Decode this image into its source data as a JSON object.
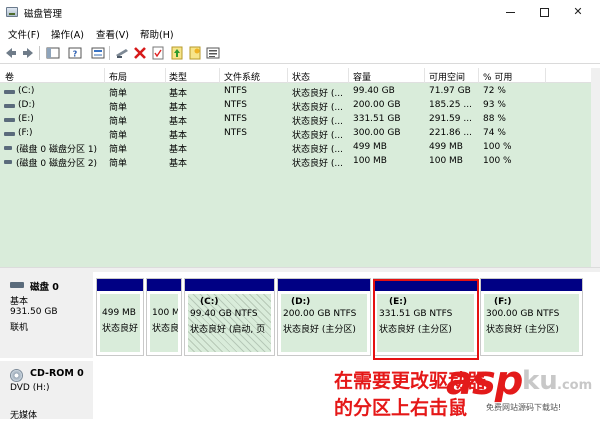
{
  "window": {
    "title": "磁盘管理",
    "min_label": "",
    "max_label": "",
    "close_label": "✕"
  },
  "menu": [
    "文件(F)",
    "操作(A)",
    "查看(V)",
    "帮助(H)"
  ],
  "toolbar_icons": [
    "back-arrow-icon",
    "forward-arrow-icon",
    "console-tree-icon",
    "help-icon",
    "properties-icon",
    "connect-drive-icon",
    "delete-icon",
    "check-icon",
    "up-folder-icon",
    "new-folder-icon",
    "list-view-icon"
  ],
  "columns": [
    "卷",
    "布局",
    "类型",
    "文件系统",
    "状态",
    "容量",
    "可用空间",
    "% 可用"
  ],
  "volumes": [
    {
      "vol": "(C:)",
      "layout": "简单",
      "type": "基本",
      "fs": "NTFS",
      "status": "状态良好 (...",
      "cap": "99.40 GB",
      "free": "71.97 GB",
      "pct": "72 %"
    },
    {
      "vol": "(D:)",
      "layout": "简单",
      "type": "基本",
      "fs": "NTFS",
      "status": "状态良好 (...",
      "cap": "200.00 GB",
      "free": "185.25 ...",
      "pct": "93 %"
    },
    {
      "vol": "(E:)",
      "layout": "简单",
      "type": "基本",
      "fs": "NTFS",
      "status": "状态良好 (...",
      "cap": "331.51 GB",
      "free": "291.59 ...",
      "pct": "88 %"
    },
    {
      "vol": "(F:)",
      "layout": "简单",
      "type": "基本",
      "fs": "NTFS",
      "status": "状态良好 (...",
      "cap": "300.00 GB",
      "free": "221.86 ...",
      "pct": "74 %"
    },
    {
      "vol": "(磁盘 0 磁盘分区 1)",
      "layout": "简单",
      "type": "基本",
      "fs": "",
      "status": "状态良好 (...",
      "cap": "499 MB",
      "free": "499 MB",
      "pct": "100 %"
    },
    {
      "vol": "(磁盘 0 磁盘分区 2)",
      "layout": "简单",
      "type": "基本",
      "fs": "",
      "status": "状态良好 (...",
      "cap": "100 MB",
      "free": "100 MB",
      "pct": "100 %"
    }
  ],
  "disk0": {
    "title": "磁盘 0",
    "type": "基本",
    "size": "931.50 GB",
    "state": "联机"
  },
  "partitions": [
    {
      "name": "",
      "size": "499 MB",
      "status": "状态良好"
    },
    {
      "name": "",
      "size": "100 M",
      "status": "状态良"
    },
    {
      "name": "(C:)",
      "size": "99.40 GB NTFS",
      "status": "状态良好 (启动, 页"
    },
    {
      "name": "(D:)",
      "size": "200.00 GB NTFS",
      "status": "状态良好 (主分区)"
    },
    {
      "name": "(E:)",
      "size": "331.51 GB NTFS",
      "status": "状态良好 (主分区)"
    },
    {
      "name": "(F:)",
      "size": "300.00 GB NTFS",
      "status": "状态良好 (主分区)"
    }
  ],
  "cdrom": {
    "title": "CD-ROM 0",
    "drive": "DVD (H:)",
    "media": "无媒体"
  },
  "annotation": {
    "line1": "在需要更改驱动器",
    "line2": "的分区上右击鼠"
  },
  "watermark": {
    "asp": "asp",
    "ku": "ku",
    "com": ".com",
    "sub": "免费网站源码下载站!"
  },
  "colors": {
    "partition_bar": "#000084",
    "volume_bg": "#d9ecda",
    "highlight": "#e51111"
  }
}
